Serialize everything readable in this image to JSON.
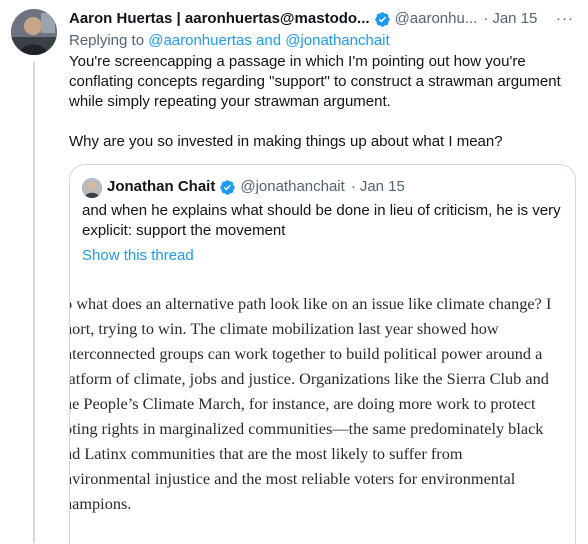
{
  "tweet": {
    "author_name": "Aaron Huertas | aaronhuertas@mastodo...",
    "author_handle": "@aaronhu...",
    "separator": "·",
    "date": "Jan 15",
    "more": "···",
    "replying_prefix": "Replying to",
    "replying_to": "@aaronhuertas and @jonathanchait",
    "paragraphs": [
      "You're screencapping a passage in which I'm pointing out how you're conflating concepts regarding \"support\" to construct a strawman argument while simply repeating your strawman argument.",
      "Why are you so invested in making things up about what I mean?"
    ]
  },
  "quoted": {
    "author_name": "Jonathan Chait",
    "author_handle": "@jonathanchait",
    "separator": "·",
    "date": "Jan 15",
    "text": "and when he explains what should be done in lieu of criticism, he is very explicit: support the movement",
    "show_thread": "Show this thread",
    "image_lines": [
      "o what does an alternative path look like on an issue like climate change? I",
      "hort, trying to win. The climate mobilization last year showed how",
      "nterconnected groups can work together to build political power around a",
      "latform of climate, jobs and justice. Organizations like the Sierra Club and",
      "ne People’s Climate March, for instance, are doing more work to protect",
      "oting rights in marginalized communities—the same predominately black",
      "nd Latinx communities that are the most likely to suffer from",
      "nvironmental injustice and the most reliable voters for environmental",
      "hampions."
    ]
  },
  "colors": {
    "link": "#1d9bf0",
    "secondary_text": "#536471",
    "primary_text": "#0f1419",
    "border": "#cfd9de"
  },
  "icons": [
    "avatar",
    "verified-badge-icon",
    "more-icon"
  ]
}
